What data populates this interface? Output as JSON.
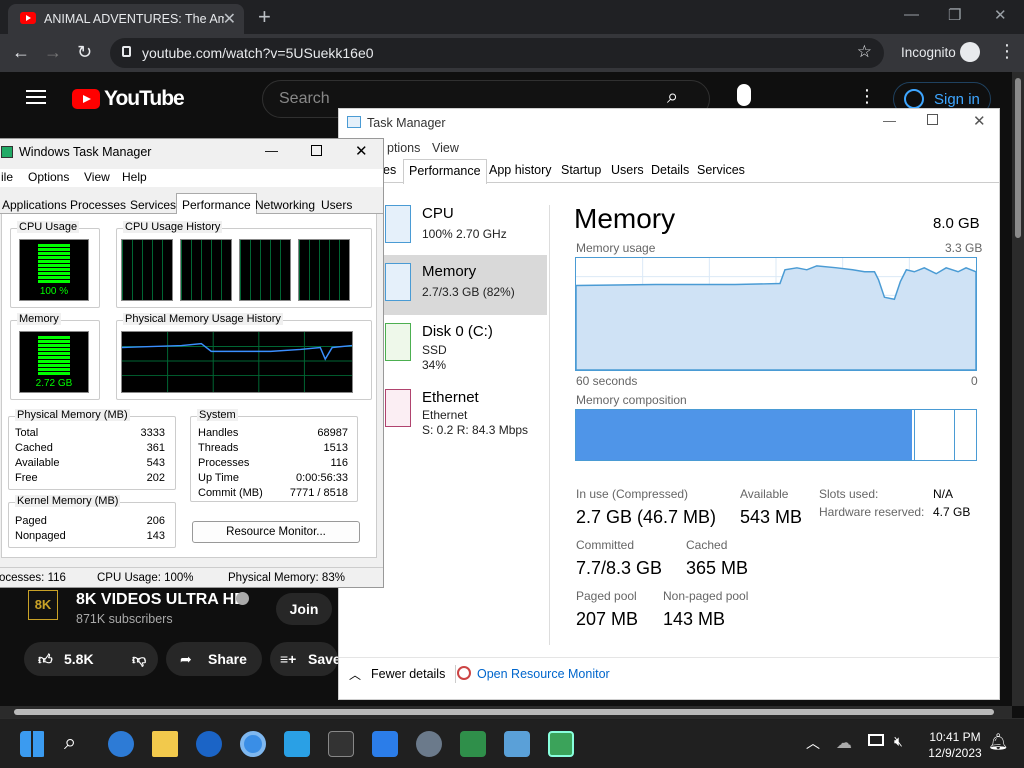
{
  "chrome": {
    "tab_title": "ANIMAL ADVENTURES: The Amazing",
    "url": "youtube.com/watch?v=5USuekk16e0",
    "incognito": "Incognito"
  },
  "youtube": {
    "logo": "YouTube",
    "search_placeholder": "Search",
    "sign_in": "Sign in",
    "channel_name": "8K VIDEOS ULTRA HD",
    "subscribers": "871K subscribers",
    "join": "Join",
    "likes": "5.8K",
    "share": "Share",
    "save": "Save",
    "logo_text": "8K"
  },
  "taskbar": {
    "time": "10:41 PM",
    "date": "12/9/2023"
  },
  "tm": {
    "title": "Task Manager",
    "menu": [
      "ptions",
      "View"
    ],
    "tabs": [
      "es",
      "Performance",
      "App history",
      "Startup",
      "Users",
      "Details",
      "Services"
    ],
    "active_tab": "Performance",
    "side": [
      {
        "name": "CPU",
        "sub1": "100%  2.70 GHz"
      },
      {
        "name": "Memory",
        "sub1": "2.7/3.3 GB (82%)"
      },
      {
        "name": "Disk 0 (C:)",
        "sub1": "SSD",
        "sub2": "34%"
      },
      {
        "name": "Ethernet",
        "sub1": "Ethernet",
        "sub2": "S: 0.2  R: 84.3 Mbps"
      }
    ],
    "heading": "Memory",
    "total": "8.0 GB",
    "usage_label": "Memory usage",
    "usage_max": "3.3 GB",
    "seconds": "60 seconds",
    "zero": "0",
    "composition": "Memory composition",
    "stats": {
      "in_use_label": "In use (Compressed)",
      "in_use": "2.7 GB (46.7 MB)",
      "available_label": "Available",
      "available": "543 MB",
      "committed_label": "Committed",
      "committed": "7.7/8.3 GB",
      "cached_label": "Cached",
      "cached": "365 MB",
      "paged_label": "Paged pool",
      "paged": "207 MB",
      "nonpaged_label": "Non-paged pool",
      "nonpaged": "143 MB",
      "slots_label": "Slots used:",
      "slots": "N/A",
      "hw_label": "Hardware reserved:",
      "hw": "4.7 GB"
    },
    "fewer": "Fewer details",
    "open_rm": "Open Resource Monitor"
  },
  "wtm": {
    "title": "Windows Task Manager",
    "menu": [
      "ile",
      "Options",
      "View",
      "Help"
    ],
    "tabs": [
      "Applications",
      "Processes",
      "Services",
      "Performance",
      "Networking",
      "Users"
    ],
    "cpu_usage": "CPU Usage",
    "cpu_value": "100 %",
    "cpu_history": "CPU Usage History",
    "memory": "Memory",
    "mem_value": "2.72 GB",
    "pm_history": "Physical Memory Usage History",
    "phys_label": "Physical Memory (MB)",
    "phys": [
      [
        "Total",
        "3333"
      ],
      [
        "Cached",
        "361"
      ],
      [
        "Available",
        "543"
      ],
      [
        "Free",
        "202"
      ]
    ],
    "sys_label": "System",
    "sys": [
      [
        "Handles",
        "68987"
      ],
      [
        "Threads",
        "1513"
      ],
      [
        "Processes",
        "116"
      ],
      [
        "Up Time",
        "0:00:56:33"
      ],
      [
        "Commit (MB)",
        "7771 / 8518"
      ]
    ],
    "kernel_label": "Kernel Memory (MB)",
    "kernel": [
      [
        "Paged",
        "206"
      ],
      [
        "Nonpaged",
        "143"
      ]
    ],
    "resource_btn": "Resource Monitor...",
    "status_proc": "ocesses: 116",
    "status_cpu": "CPU Usage: 100%",
    "status_mem": "Physical Memory: 83%"
  }
}
